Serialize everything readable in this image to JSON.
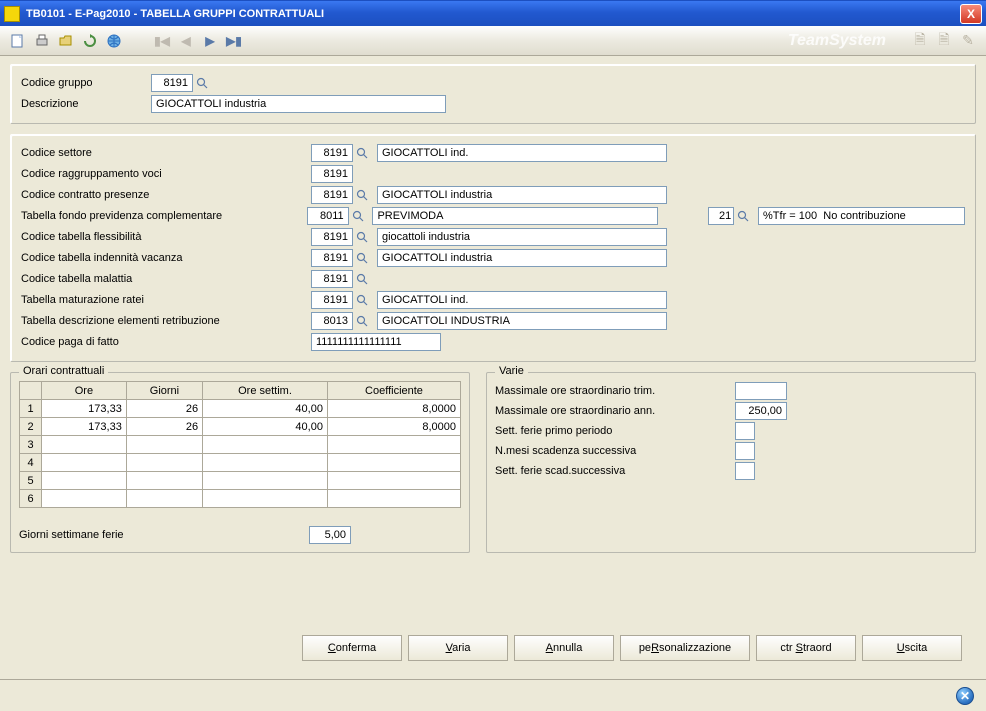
{
  "title": "TB0101  - E-Pag2010  -   TABELLA GRUPPI CONTRATTUALI",
  "header": {
    "codice_gruppo_label": "Codice gruppo",
    "codice_gruppo": "8191",
    "descrizione_label": "Descrizione",
    "descrizione": "GIOCATTOLI industria"
  },
  "fields": [
    {
      "label": "Codice settore",
      "code": "8191",
      "lookup": true,
      "desc": "GIOCATTOLI ind."
    },
    {
      "label": "Codice raggruppamento voci",
      "code": "8191",
      "lookup": false,
      "desc": null
    },
    {
      "label": "Codice contratto presenze",
      "code": "8191",
      "lookup": true,
      "desc": "GIOCATTOLI industria"
    },
    {
      "label": "Tabella fondo previdenza complementare",
      "code": "8011",
      "lookup": true,
      "desc": "PREVIMODA",
      "extra_code": "21",
      "extra_desc": "%Tfr = 100  No contribuzione"
    },
    {
      "label": "Codice tabella flessibilità",
      "code": "8191",
      "lookup": true,
      "desc": "giocattoli industria"
    },
    {
      "label": "Codice tabella indennità vacanza",
      "code": "8191",
      "lookup": true,
      "desc": "GIOCATTOLI industria"
    },
    {
      "label": "Codice tabella malattia",
      "code": "8191",
      "lookup": true,
      "desc": null
    },
    {
      "label": "Tabella maturazione ratei",
      "code": "8191",
      "lookup": true,
      "desc": "GIOCATTOLI ind."
    },
    {
      "label": "Tabella descrizione elementi retribuzione",
      "code": "8013",
      "lookup": true,
      "desc": "GIOCATTOLI INDUSTRIA"
    }
  ],
  "codice_paga_label": "Codice paga di fatto",
  "codice_paga_value": "1111111111111111",
  "orari": {
    "legend": "Orari contrattuali",
    "columns": [
      "",
      "Ore",
      "Giorni",
      "Ore settim.",
      "Coefficiente"
    ],
    "rows": [
      [
        "1",
        "173,33",
        "26",
        "40,00",
        "8,0000"
      ],
      [
        "2",
        "173,33",
        "26",
        "40,00",
        "8,0000"
      ],
      [
        "3",
        "",
        "",
        "",
        ""
      ],
      [
        "4",
        "",
        "",
        "",
        ""
      ],
      [
        "5",
        "",
        "",
        "",
        ""
      ],
      [
        "6",
        "",
        "",
        "",
        ""
      ]
    ],
    "giorni_sett_label": "Giorni settimane ferie",
    "giorni_sett_value": "5,00"
  },
  "varie": {
    "legend": "Varie",
    "rows": [
      {
        "label": "Massimale ore straordinario trim.",
        "value": ""
      },
      {
        "label": "Massimale ore straordinario ann.",
        "value": "250,00"
      },
      {
        "label": "Sett. ferie  primo periodo",
        "value": "",
        "small": true
      },
      {
        "label": "N.mesi scadenza successiva",
        "value": "",
        "small": true
      },
      {
        "label": "Sett. ferie scad.successiva",
        "value": "",
        "small": true
      }
    ]
  },
  "buttons": {
    "conferma": "Conferma",
    "varia": "Varia",
    "annulla": "Annulla",
    "personalizzazione": "peRsonalizzazione",
    "ctr_straord": "ctr Straord",
    "uscita": "Uscita"
  },
  "toolbar_brand": "TeamSystem"
}
